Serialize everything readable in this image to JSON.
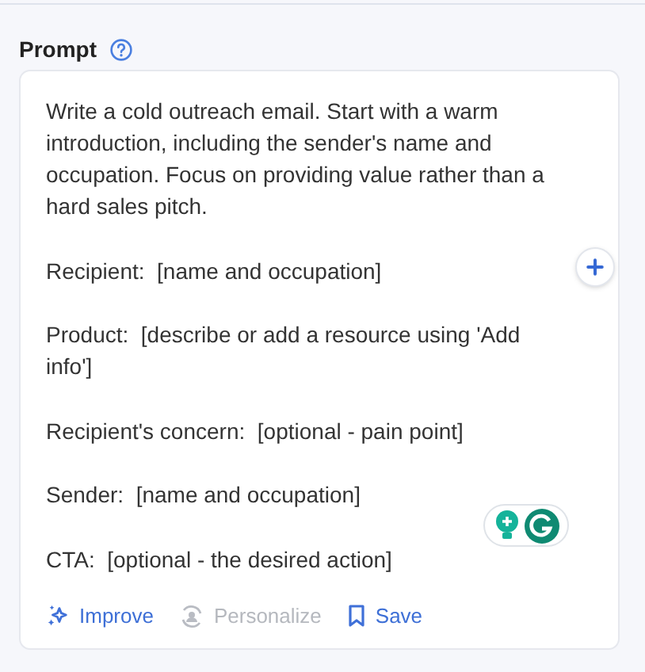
{
  "section": {
    "title": "Prompt"
  },
  "prompt": {
    "paragraphs": [
      "Write a cold outreach email. Start with a warm introduction, including the sender's name and occupation. Focus on providing value rather than a hard sales pitch.",
      "Recipient:  [name and occupation]",
      "Product:  [describe or add a resource using 'Add info']",
      "Recipient's concern:  [optional - pain point]",
      "Sender:  [name and occupation]",
      "CTA:  [optional - the desired action]"
    ]
  },
  "actions": [
    {
      "kind": "improve",
      "label": "Improve",
      "disabled": false
    },
    {
      "kind": "personalize",
      "label": "Personalize",
      "disabled": true
    },
    {
      "kind": "save",
      "label": "Save",
      "disabled": false
    }
  ]
}
